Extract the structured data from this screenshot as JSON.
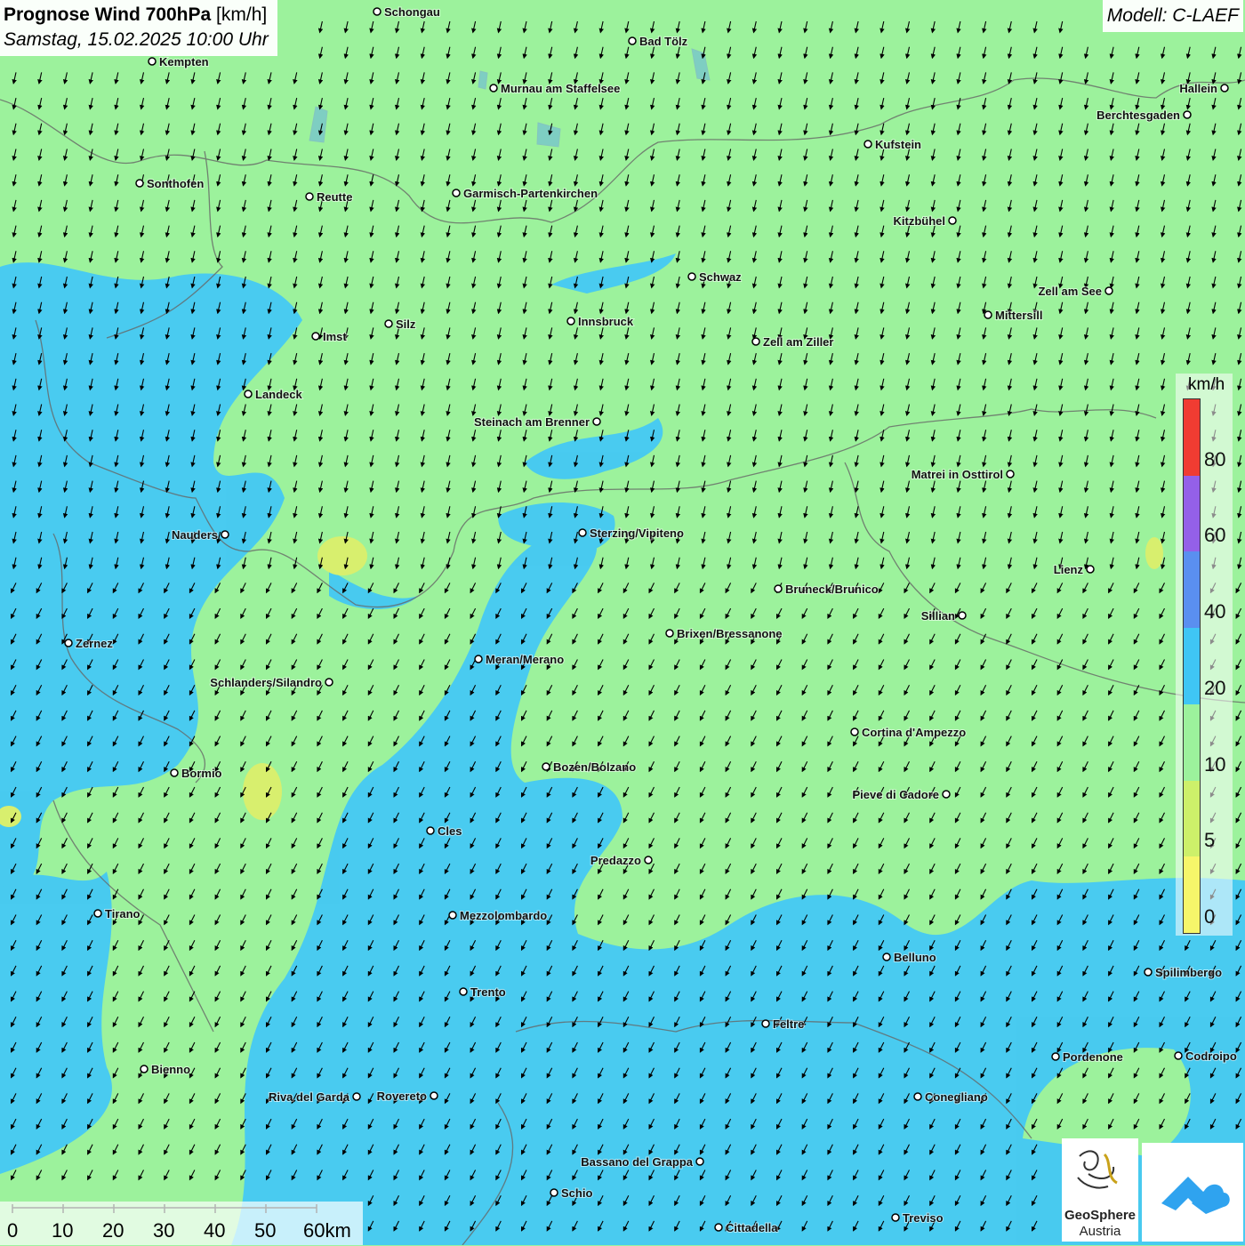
{
  "title": {
    "main": "Prognose Wind 700hPa",
    "unit": "[km/h]",
    "datetime": "Samstag, 15.02.2025 10:00 Uhr"
  },
  "model": "Modell: C-LAEF",
  "legend": {
    "unit": "km/h",
    "labels": [
      "0",
      "5",
      "10",
      "20",
      "40",
      "60",
      "80"
    ],
    "bands": [
      {
        "from": 0,
        "to": 5,
        "color": "#f6f66a"
      },
      {
        "from": 5,
        "to": 10,
        "color": "#cdf06a"
      },
      {
        "from": 10,
        "to": 20,
        "color": "#9cf29c"
      },
      {
        "from": 20,
        "to": 40,
        "color": "#3fc6f5"
      },
      {
        "from": 40,
        "to": 60,
        "color": "#5a8ff0"
      },
      {
        "from": 60,
        "to": 80,
        "color": "#9460e8"
      },
      {
        "from": 80,
        "to": 100,
        "color": "#f03c32"
      }
    ]
  },
  "scale_bar": {
    "labels": [
      "0",
      "10",
      "20",
      "30",
      "40",
      "50",
      "60km"
    ]
  },
  "logo": {
    "line1": "GeoSphere",
    "line2": "Austria"
  },
  "wind_direction": "from north-east (arrows pointing south-west / south)",
  "cities": [
    {
      "name": "Schongau"
    },
    {
      "name": "Kempten"
    },
    {
      "name": "Bad Tölz"
    },
    {
      "name": "Murnau am Staffelsee"
    },
    {
      "name": "Hallein"
    },
    {
      "name": "Berchtesgaden"
    },
    {
      "name": "Kufstein"
    },
    {
      "name": "Sonthofen"
    },
    {
      "name": "Reutte"
    },
    {
      "name": "Garmisch-Partenkirchen"
    },
    {
      "name": "Kitzbühel"
    },
    {
      "name": "Schwaz"
    },
    {
      "name": "Zell am See"
    },
    {
      "name": "Innsbruck"
    },
    {
      "name": "Mittersill"
    },
    {
      "name": "Silz"
    },
    {
      "name": "Imst"
    },
    {
      "name": "Zell am Ziller"
    },
    {
      "name": "Landeck"
    },
    {
      "name": "Steinach am Brenner"
    },
    {
      "name": "Matrei in Osttirol"
    },
    {
      "name": "Nauders"
    },
    {
      "name": "Sterzing/Vipiteno"
    },
    {
      "name": "Lienz"
    },
    {
      "name": "Bruneck/Brunico"
    },
    {
      "name": "Sillian"
    },
    {
      "name": "Brixen/Bressanone"
    },
    {
      "name": "Zernez"
    },
    {
      "name": "Meran/Merano"
    },
    {
      "name": "Schlanders/Silandro"
    },
    {
      "name": "Cortina d'Ampezzo"
    },
    {
      "name": "Bozen/Bolzano"
    },
    {
      "name": "Bormio"
    },
    {
      "name": "Pieve di Cadore"
    },
    {
      "name": "Cles"
    },
    {
      "name": "Predazzo"
    },
    {
      "name": "Tirano"
    },
    {
      "name": "Mezzolombardo"
    },
    {
      "name": "Belluno"
    },
    {
      "name": "Spilimbergo"
    },
    {
      "name": "Trento"
    },
    {
      "name": "Feltre"
    },
    {
      "name": "Pordenone"
    },
    {
      "name": "Codroipo"
    },
    {
      "name": "Bienno"
    },
    {
      "name": "Riva del Garda"
    },
    {
      "name": "Rovereto"
    },
    {
      "name": "Conegliano"
    },
    {
      "name": "Bassano del Grappa"
    },
    {
      "name": "Schio"
    },
    {
      "name": "Treviso"
    },
    {
      "name": "Cittadella"
    }
  ]
}
